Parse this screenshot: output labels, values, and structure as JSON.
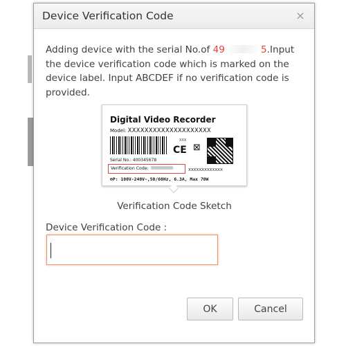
{
  "dialog": {
    "title": "Device Verification Code",
    "close_glyph": "×",
    "message_prefix": "Adding device with the serial No.of ",
    "serial_start": "49",
    "serial_end": "5",
    "message_suffix": ".Input the device verification code which is marked on the device label. Input ABCDEF if no verification code is provided.",
    "sketch_caption": "Verification Code Sketch",
    "field_label": "Device Verification Code :",
    "input_value": "",
    "ok_label": "OK",
    "cancel_label": "Cancel"
  },
  "label_sketch": {
    "title": "Digital Video Recorder",
    "model_label": "Model:",
    "model_value": "XXXXXXXXXXXXXXXXXXXX",
    "small_xxx": "XXX",
    "ce_mark": "CE",
    "bin_glyph": "⊠",
    "serial_label": "Serial No.:",
    "serial_value": "400345678",
    "verification_label": "Verification Code:",
    "x_line": "XXXXXXXXXXXXX",
    "power_line": "⊕P: 100V-240V~,50/60Hz, 6.3A, Max 70W"
  },
  "colors": {
    "serial_highlight": "#e8413a",
    "label_frame": "#d9453c",
    "input_focus_border": "#e8956a"
  }
}
